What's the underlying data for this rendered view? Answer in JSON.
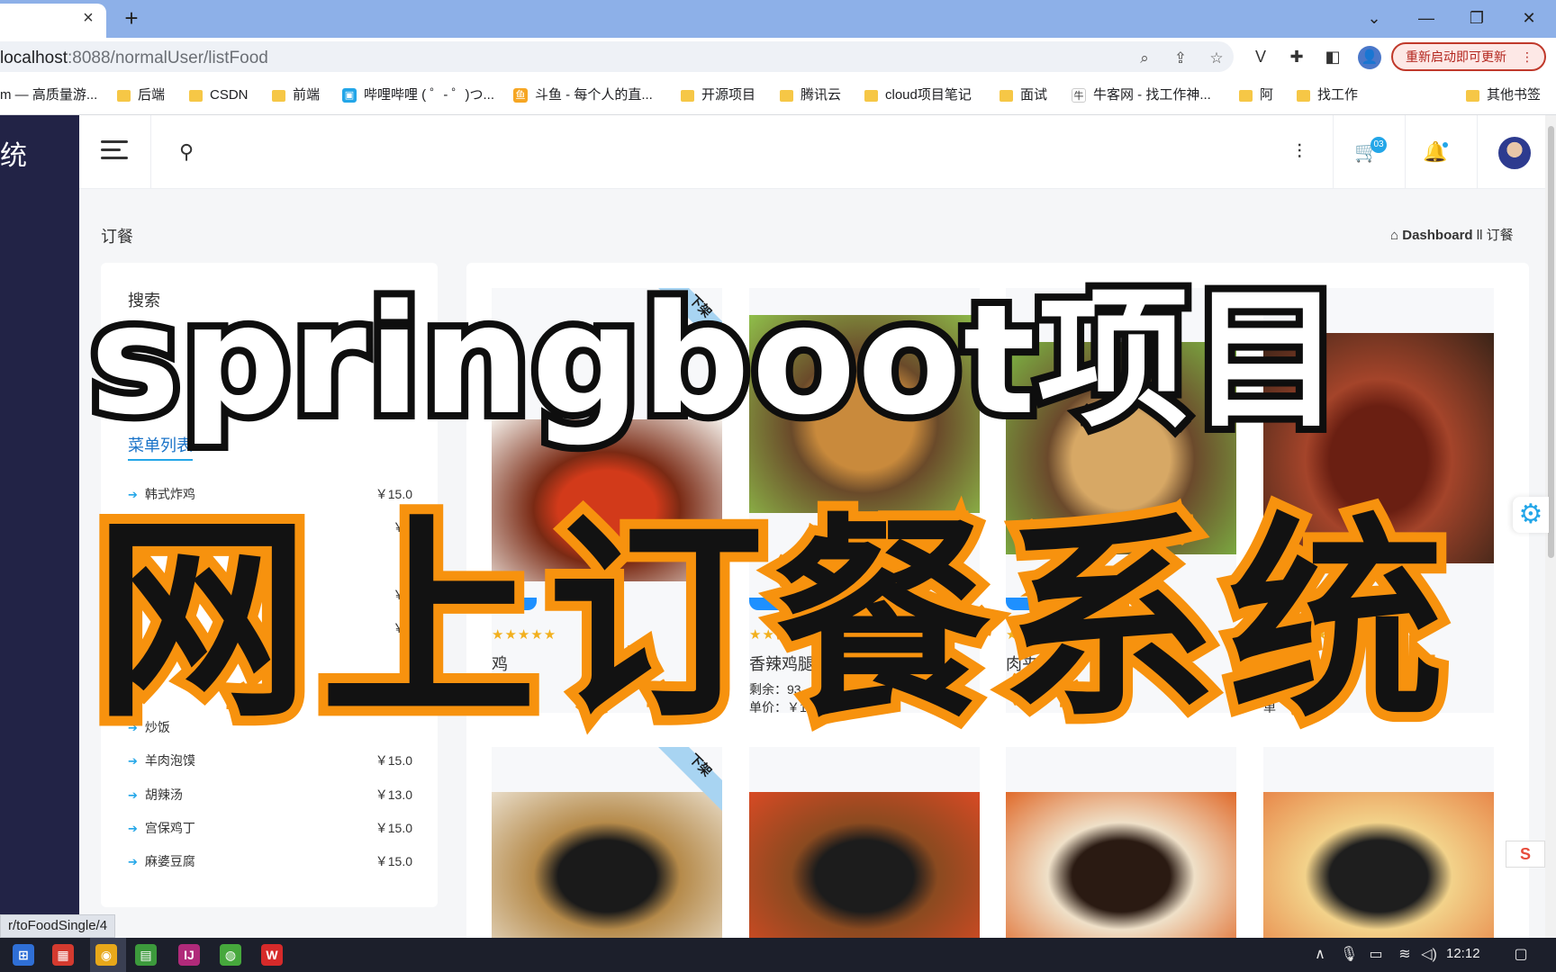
{
  "browser": {
    "tab_close": "×",
    "new_tab": "+",
    "window_controls": {
      "dropdown": "⌄",
      "minimize": "—",
      "restore": "❐",
      "close": "✕"
    },
    "url_host": "localhost",
    "url_path": ":8088/normalUser/listFood",
    "update_button": "重新启动即可更新",
    "update_dots": "⋮",
    "profile_letter": "👤",
    "bookmarks": [
      {
        "label": "m — 高质量游...",
        "kind": "text"
      },
      {
        "label": "后端",
        "kind": "folder"
      },
      {
        "label": "CSDN",
        "kind": "folder"
      },
      {
        "label": "前端",
        "kind": "folder"
      },
      {
        "label": "哔哩哔哩 ( ゜- ゜)つ...",
        "kind": "bilibili"
      },
      {
        "label": "斗鱼 - 每个人的直...",
        "kind": "douyu"
      },
      {
        "label": "开源项目",
        "kind": "folder"
      },
      {
        "label": "腾讯云",
        "kind": "folder"
      },
      {
        "label": "cloud项目笔记",
        "kind": "folder"
      },
      {
        "label": "面试",
        "kind": "folder"
      },
      {
        "label": "牛客网 - 找工作神...",
        "kind": "nowcoder"
      },
      {
        "label": "阿",
        "kind": "folder"
      },
      {
        "label": "找工作",
        "kind": "folder"
      }
    ],
    "other_bookmarks": "其他书签",
    "status_url": "r/toFoodSingle/4"
  },
  "app": {
    "brand_fragment": "统",
    "cart_badge": "03",
    "page_title": "订餐",
    "breadcrumb_home": "Dashboard",
    "breadcrumb_sep": "ll",
    "breadcrumb_current": "订餐",
    "search_label": "搜索",
    "menu_title": "菜单列表",
    "menu_items": [
      {
        "name": "韩式炸鸡",
        "price": "￥15.0"
      },
      {
        "name": "",
        "price": "￥1"
      },
      {
        "name": "",
        "price": "￥"
      },
      {
        "name": "",
        "price": "￥2"
      },
      {
        "name": "",
        "price": "￥1"
      },
      {
        "name": "炒饭",
        "price": ""
      },
      {
        "name": "羊肉泡馍",
        "price": "￥15.0"
      },
      {
        "name": "胡辣汤",
        "price": "￥13.0"
      },
      {
        "name": "宫保鸡丁",
        "price": "￥15.0"
      },
      {
        "name": "麻婆豆腐",
        "price": "￥15.0"
      }
    ],
    "foods_row1": [
      {
        "name": "鸡",
        "stock": "",
        "price": "5.0",
        "ribbon": "下架",
        "colors": [
          "#d23a1a",
          "#7a2a14",
          "#f4efe9"
        ]
      },
      {
        "name": "香辣鸡腿",
        "stock": "剩余：93",
        "price": "单价：￥12.0",
        "ribbon": "",
        "colors": [
          "#c98a3c",
          "#6a4a2a",
          "#8fbf4a"
        ]
      },
      {
        "name": "肉夹",
        "stock": "剩余",
        "price": "",
        "ribbon": "",
        "colors": [
          "#d7a865",
          "#6b4a2c",
          "#7db944"
        ]
      },
      {
        "name": "肌",
        "stock": "剩",
        "price": "单",
        "ribbon": "",
        "colors": [
          "#6a1f12",
          "#a4442a",
          "#3a2418"
        ]
      }
    ],
    "foods_row2": [
      {
        "ribbon": "下架",
        "colors": [
          "#1a1a1a",
          "#b58a4a",
          "#e8dcc8"
        ]
      },
      {
        "ribbon": "",
        "colors": [
          "#1c1c1c",
          "#8a4a20",
          "#d84a24"
        ]
      },
      {
        "ribbon": "",
        "colors": [
          "#2a1a12",
          "#efe0c8",
          "#e06a2a"
        ]
      },
      {
        "ribbon": "",
        "colors": [
          "#1e1e1e",
          "#f2d28a",
          "#e8884a"
        ]
      }
    ],
    "stars": "★★★★★"
  },
  "overlay": {
    "english": "springboot项目",
    "chinese": "网上订餐系统"
  },
  "taskbar": {
    "clock": "12:12"
  },
  "colors": {
    "accent": "#23a6e8",
    "nav_bg": "#222346",
    "overlay_orange": "#f7920e"
  }
}
